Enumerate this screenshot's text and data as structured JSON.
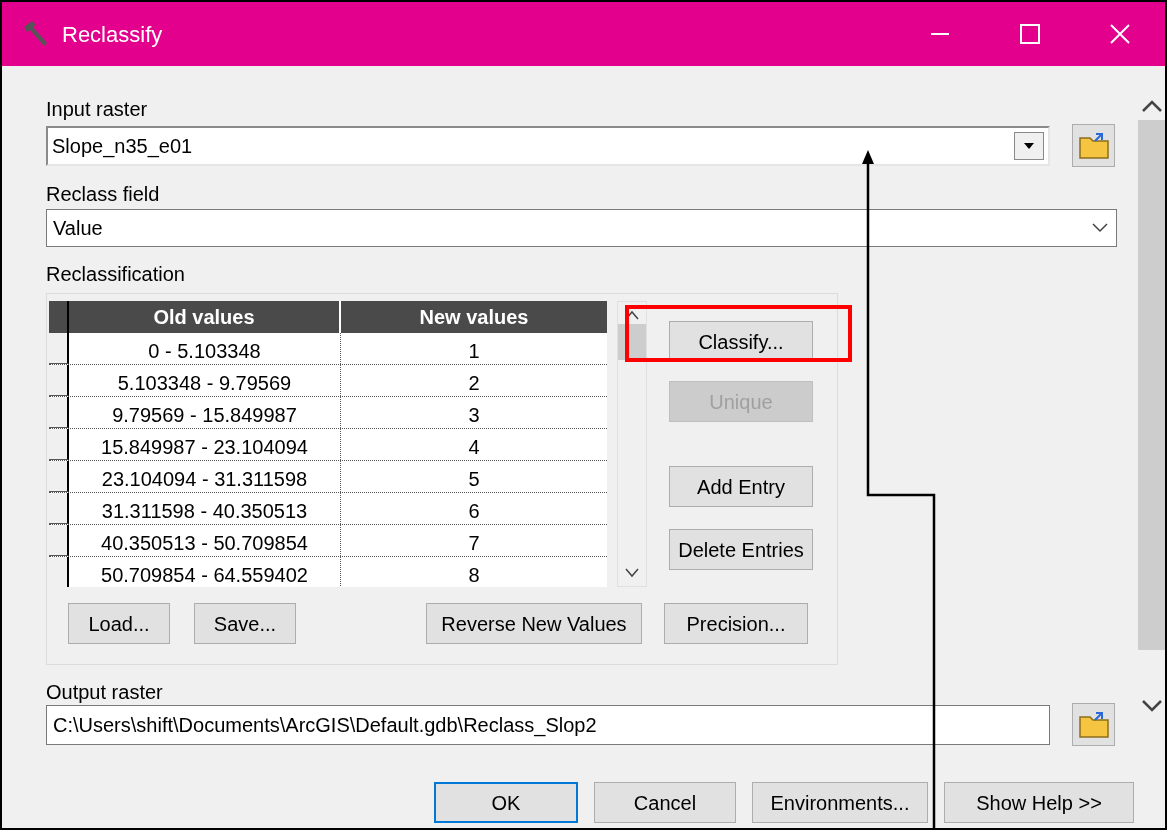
{
  "window": {
    "title": "Reclassify"
  },
  "input_raster": {
    "label": "Input raster",
    "value": "Slope_n35_e01"
  },
  "reclass_field": {
    "label": "Reclass field",
    "value": "Value"
  },
  "reclassification": {
    "label": "Reclassification",
    "columns": [
      "Old values",
      "New values"
    ],
    "rows": [
      {
        "old": "0 - 5.103348",
        "new": "1"
      },
      {
        "old": "5.103348 - 9.79569",
        "new": "2"
      },
      {
        "old": "9.79569 - 15.849987",
        "new": "3"
      },
      {
        "old": "15.849987 - 23.104094",
        "new": "4"
      },
      {
        "old": "23.104094 - 31.311598",
        "new": "5"
      },
      {
        "old": "31.311598 - 40.350513",
        "new": "6"
      },
      {
        "old": "40.350513 - 50.709854",
        "new": "7"
      },
      {
        "old": "50.709854 - 64.559402",
        "new": "8"
      }
    ],
    "side_buttons": [
      {
        "label": "Classify...",
        "disabled": false,
        "highlighted": true
      },
      {
        "label": "Unique",
        "disabled": true,
        "highlighted": false
      },
      {
        "label": "Add Entry",
        "disabled": false,
        "highlighted": false
      },
      {
        "label": "Delete Entries",
        "disabled": false,
        "highlighted": false
      }
    ],
    "bottom_buttons": [
      {
        "label": "Load..."
      },
      {
        "label": "Save..."
      },
      {
        "label": "Reverse New Values"
      },
      {
        "label": "Precision..."
      }
    ]
  },
  "output_raster": {
    "label": "Output raster",
    "value": "C:\\Users\\shift\\Documents\\ArcGIS\\Default.gdb\\Reclass_Slop2"
  },
  "footer_buttons": [
    {
      "label": "OK",
      "focused": true
    },
    {
      "label": "Cancel",
      "focused": false
    },
    {
      "label": "Environments...",
      "focused": false
    },
    {
      "label": "Show Help >>",
      "focused": false
    }
  ]
}
